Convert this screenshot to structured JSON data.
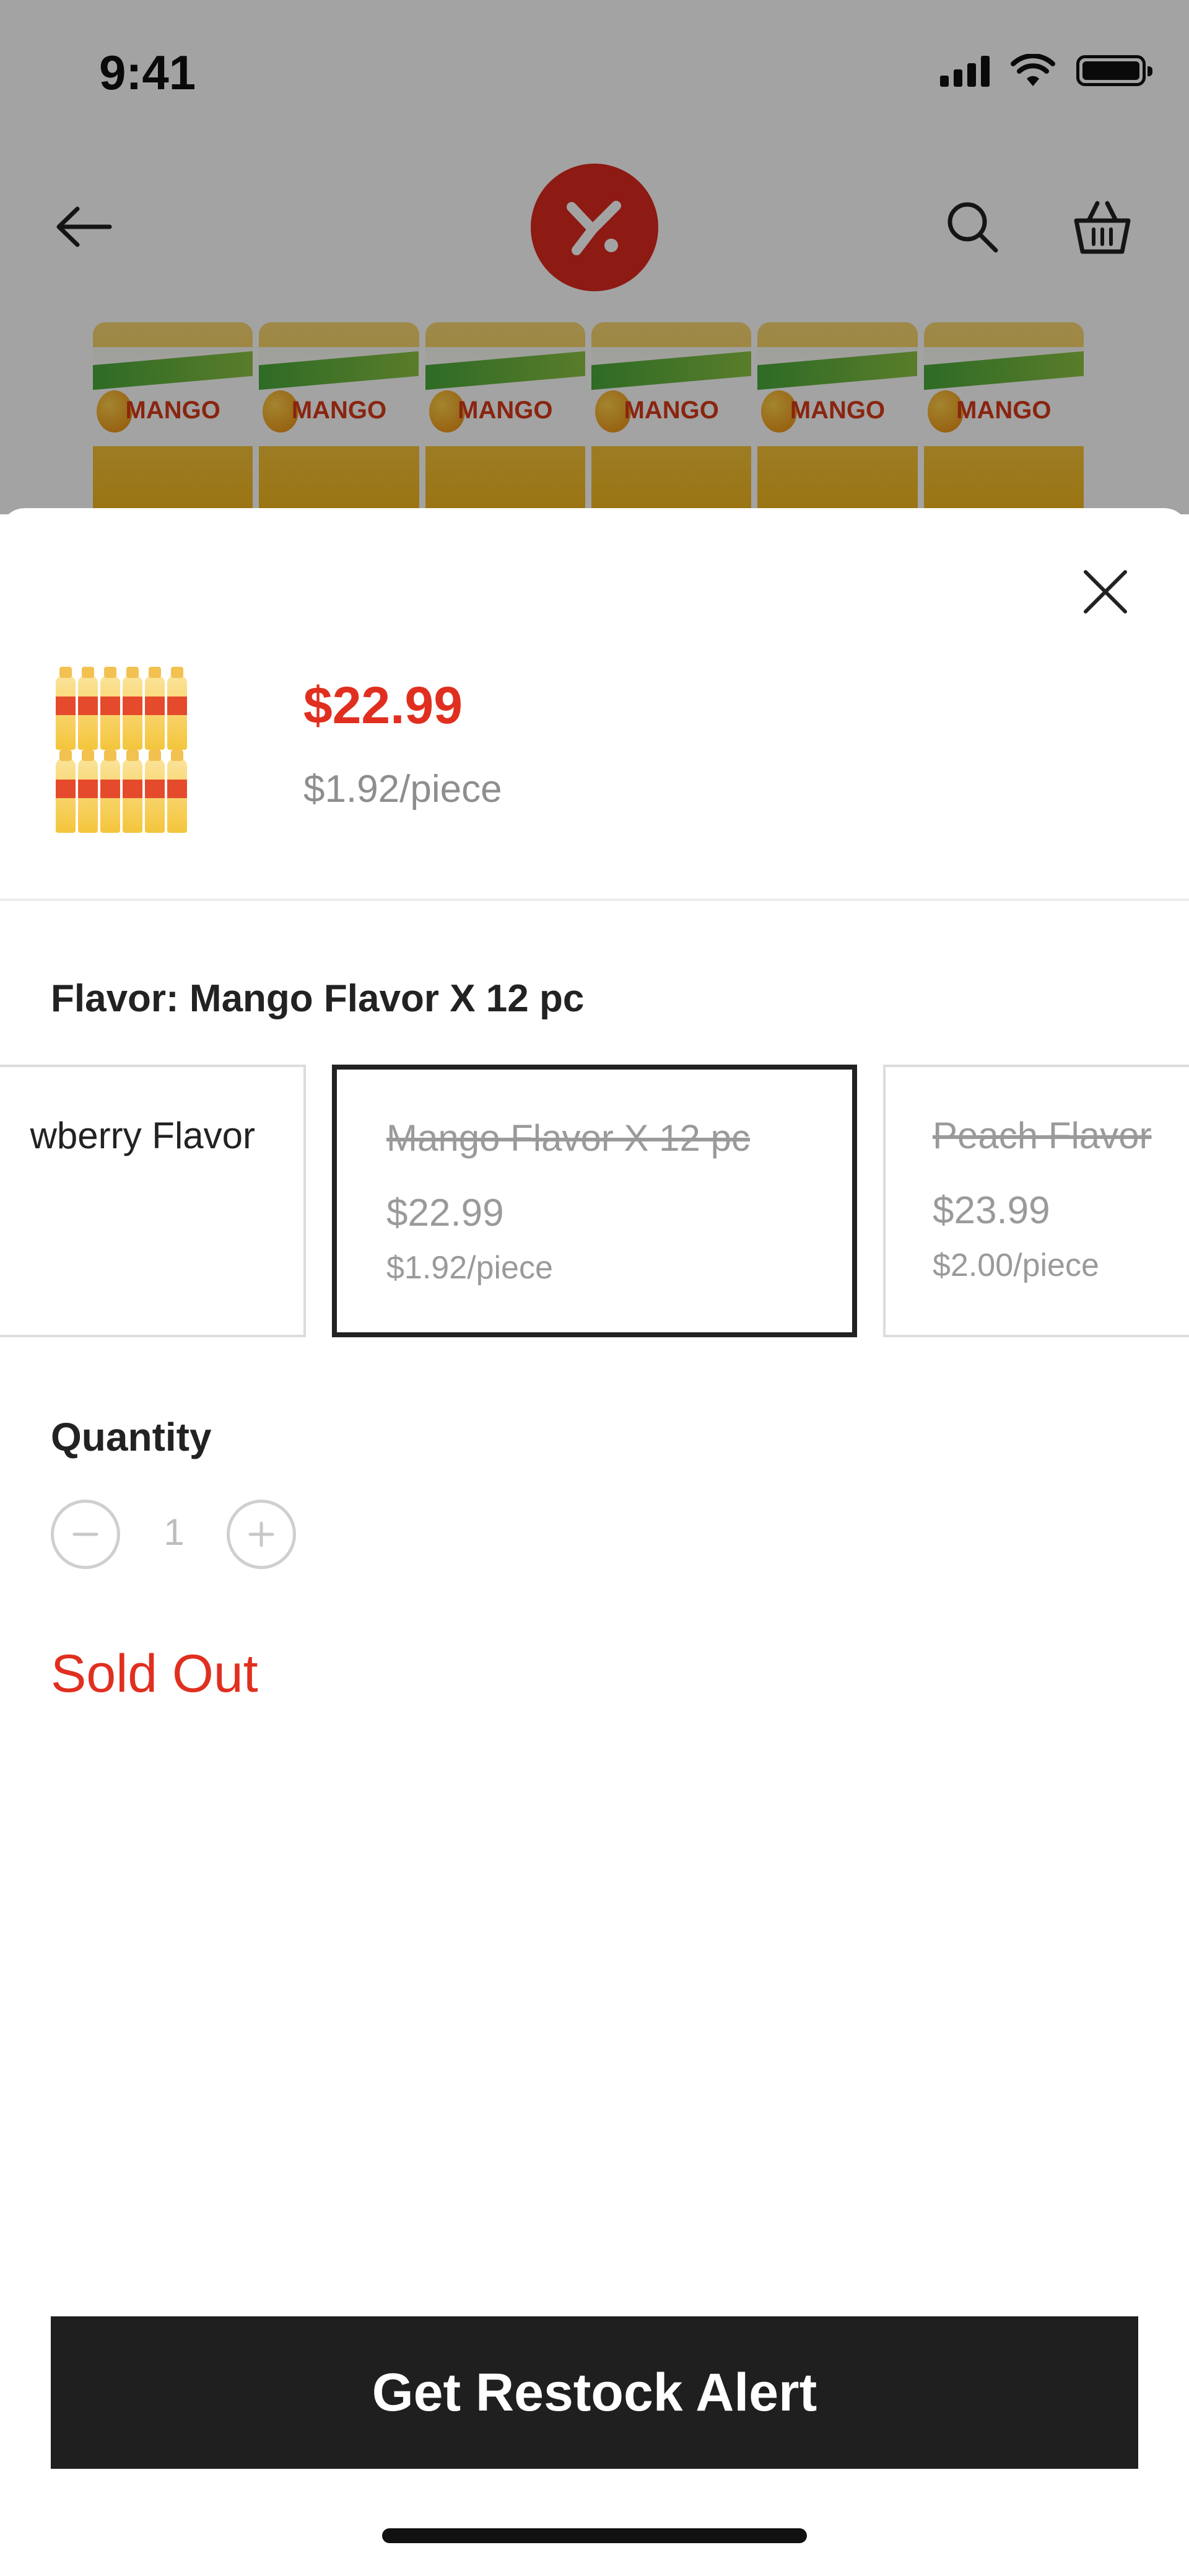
{
  "status_bar": {
    "time": "9:41"
  },
  "nav": {
    "logo_alt": "app logo"
  },
  "hero": {
    "bottle_label": "MANGO",
    "bottle_count": 6
  },
  "sheet": {
    "price": "$22.99",
    "unit_price": "$1.92/piece",
    "flavor_heading": "Flavor: Mango Flavor X 12 pc",
    "options": [
      {
        "name": "wberry Flavor",
        "price": "",
        "unit": ""
      },
      {
        "name": "Mango Flavor X 12 pc",
        "price": "$22.99",
        "unit": "$1.92/piece",
        "selected": true
      },
      {
        "name": "Peach Flavor",
        "price": "$23.99",
        "unit": "$2.00/piece"
      }
    ],
    "quantity_label": "Quantity",
    "quantity_value": "1",
    "status": "Sold Out",
    "cta_label": "Get Restock Alert"
  },
  "colors": {
    "accent": "#e02f1f",
    "cta_bg": "#1f1f1f",
    "logo_bg": "#dd2a1f"
  },
  "icons": [
    "back-arrow-icon",
    "search-icon",
    "cart-icon",
    "close-icon",
    "minus-icon",
    "plus-icon",
    "signal-icon",
    "wifi-icon",
    "battery-icon"
  ]
}
